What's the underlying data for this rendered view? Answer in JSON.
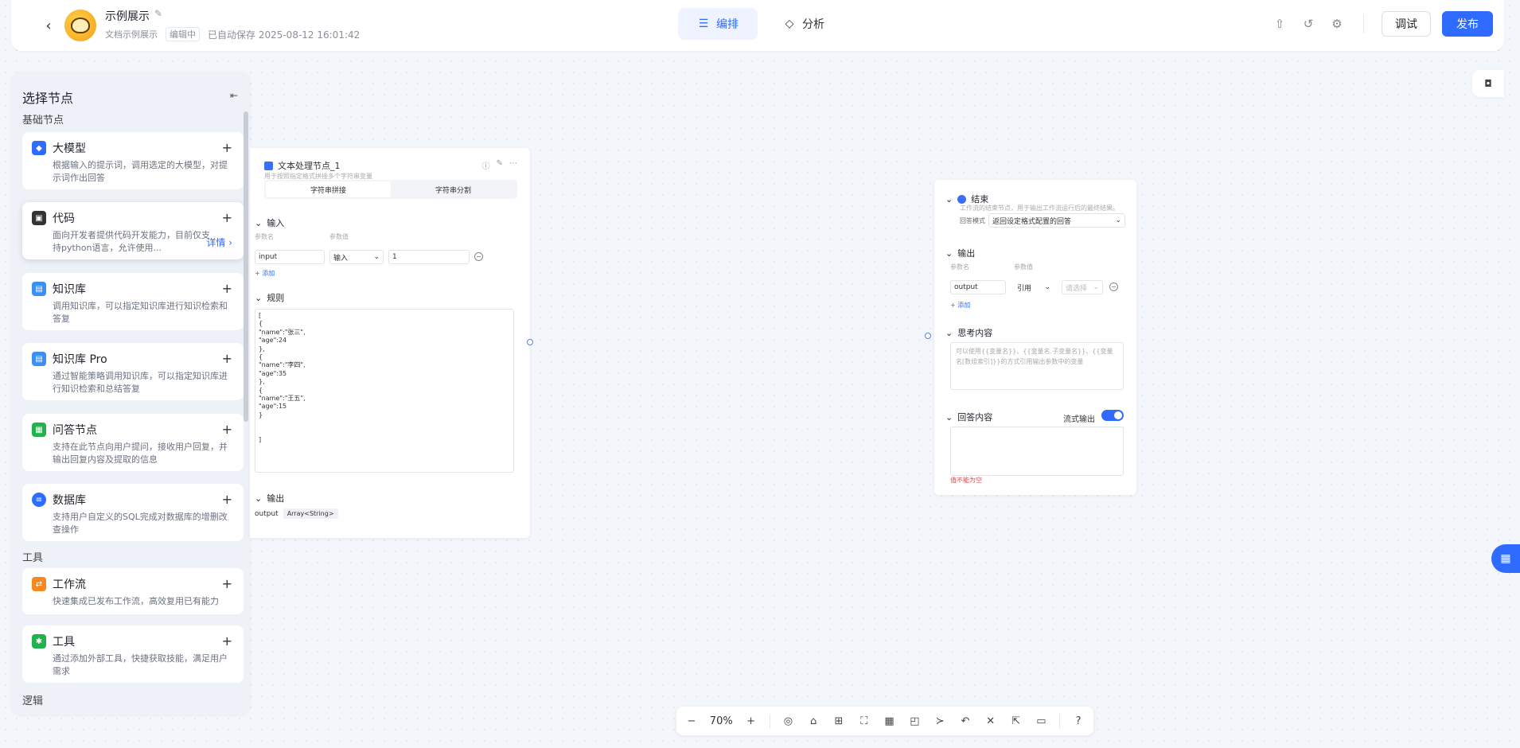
{
  "header": {
    "back_icon": "chevron-left-icon",
    "title": "示例展示",
    "subtitle": "文档示例展示",
    "status_tag": "编辑中",
    "saved_text": "已自动保存 2025-08-12 16:01:42",
    "tabs": [
      {
        "label": "编排",
        "icon": "layout-icon",
        "active": true
      },
      {
        "label": "分析",
        "icon": "cube-icon",
        "active": false
      }
    ],
    "debug_label": "调试",
    "publish_label": "发布"
  },
  "panel": {
    "title": "选择节点",
    "group_basic": "基础节点",
    "group_tools": "工具",
    "group_logic": "逻辑",
    "detail_label": "详情",
    "nodes": [
      {
        "name": "大模型",
        "desc": "根据输入的提示词，调用选定的大模型，对提示词作出回答",
        "color": "#2f6bff"
      },
      {
        "name": "代码",
        "desc": "面向开发者提供代码开发能力，目前仅支持python语言，允许使用...",
        "color": "#333333"
      },
      {
        "name": "知识库",
        "desc": "调用知识库，可以指定知识库进行知识检索和答复",
        "color": "#3a8ef6"
      },
      {
        "name": "知识库 Pro",
        "desc": "通过智能策略调用知识库，可以指定知识库进行知识检索和总结答复",
        "color": "#3a8ef6"
      },
      {
        "name": "问答节点",
        "desc": "支持在此节点向用户提问，接收用户回复，并输出回复内容及提取的信息",
        "color": "#22b14c"
      },
      {
        "name": "数据库",
        "desc": "支持用户自定义的SQL完成对数据库的增删改查操作",
        "color": "#2f6bff"
      },
      {
        "name": "工作流",
        "desc": "快速集成已发布工作流，高效复用已有能力",
        "color": "#f5891f"
      },
      {
        "name": "工具",
        "desc": "通过添加外部工具，快捷获取技能，满足用户需求",
        "color": "#22b14c"
      }
    ]
  },
  "text_node": {
    "title": "文本处理节点_1",
    "desc": "用于按照指定格式拼接多个字符串变量",
    "seg_concat": "字符串拼接",
    "seg_split": "字符串分割",
    "input_label": "输入",
    "param_name_label": "参数名",
    "param_value_label": "参数值",
    "param_name": "input",
    "param_type": "输入",
    "param_value": "1",
    "add_label": "+ 添加",
    "rule_label": "规则",
    "rule_text": "[\n{\n\"name\":\"张三\",\n\"age\":24\n},\n{\n\"name\":\"李四\",\n\"age\":35\n},\n{\n\"name\":\"王五\",\n\"age\":15\n}\n\n\n]",
    "output_label": "输出",
    "output_name": "output",
    "output_type": "Array<String>"
  },
  "end_node": {
    "title": "结束",
    "desc": "工作流的结束节点，用于输出工作流运行后的最终结果。",
    "mode_label": "回答模式",
    "mode_value": "返回设定格式配置的回答",
    "output_label": "输出",
    "param_name_label": "参数名",
    "param_value_label": "参数值",
    "output_name": "output",
    "output_ref": "引用",
    "output_select": "请选择",
    "add_label": "+ 添加",
    "think_label": "思考内容",
    "think_placeholder": "可以使用{{变量名}}、{{变量名.子变量名}}、{{变量名[数组索引]}}的方式引用输出参数中的变量",
    "answer_label": "回答内容",
    "stream_label": "流式输出",
    "stream_on": true,
    "error_text": "值不能为空"
  },
  "toolbar": {
    "zoom": "70%",
    "icons": [
      "locate-icon",
      "clean-icon",
      "add-node-icon",
      "fit-view-icon",
      "layout-icon",
      "minimap-icon",
      "connector-icon",
      "undo-icon",
      "collapse-icon",
      "export-icon",
      "comment-icon",
      "help-icon"
    ]
  }
}
